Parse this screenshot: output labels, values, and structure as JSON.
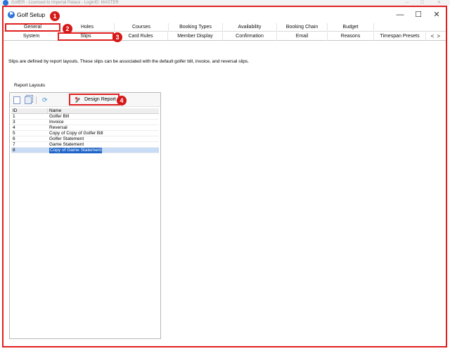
{
  "outer_window": {
    "title": "GolfER - Licensed to Imperial Palace - LoginID: MASTER",
    "controls": [
      "—",
      "☐",
      "✕"
    ]
  },
  "window": {
    "title": "Golf Setup",
    "controls": {
      "minimize": "—",
      "maximize": "☐",
      "close": "✕"
    }
  },
  "badges": [
    "1",
    "2",
    "3",
    "4"
  ],
  "tabs_row1": [
    "General",
    "Holes",
    "Courses",
    "Booking Types",
    "Availability",
    "Booking Chain",
    "Budget"
  ],
  "tabs_row2": [
    "System",
    "Slips",
    "Card Rules",
    "Member Display",
    "Confirmation",
    "Email",
    "Reasons",
    "Timespan Presets"
  ],
  "tab_scroll": {
    "left": "<",
    "right": ">"
  },
  "selected_tab_row1": "General",
  "selected_tab_row2": "Slips",
  "description": "Slips are defined by report layouts. These slips can be associated with the default golfer bill, invoice, and reversal slips.",
  "group_label": "Report Layouts",
  "toolbar": {
    "design_label": "Design Report",
    "icons": [
      "new-document-icon",
      "copy-icon",
      "refresh-icon",
      "design-report-icon"
    ]
  },
  "table": {
    "headers": {
      "id": "ID",
      "name": "Name"
    },
    "rows": [
      {
        "id": "1",
        "name": "Golfer Bill"
      },
      {
        "id": "3",
        "name": "Invoice"
      },
      {
        "id": "4",
        "name": "Reversal"
      },
      {
        "id": "5",
        "name": "Copy of Copy of Golfer Bill"
      },
      {
        "id": "6",
        "name": "Golfer Statement"
      },
      {
        "id": "7",
        "name": "Game Statement"
      },
      {
        "id": "8",
        "name": "Copy of Game Statement"
      }
    ],
    "selected_id": "8"
  },
  "colors": {
    "highlight_red": "#e02020",
    "badge_red": "#d61818",
    "selection_blue": "#1e64c8",
    "app_icon_blue": "#2a73d8"
  }
}
